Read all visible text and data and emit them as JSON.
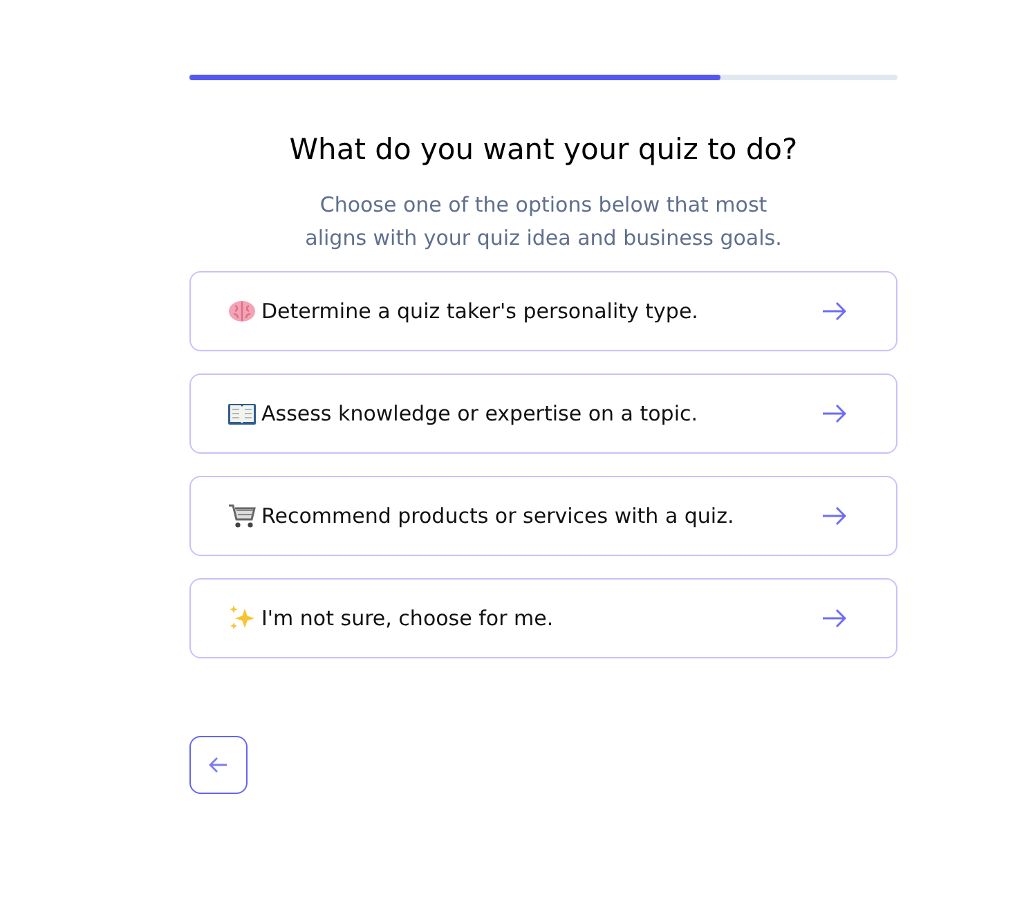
{
  "progress": {
    "level": 0.75
  },
  "title": "What do you want your quiz to do?",
  "subtitle": "Choose one of the options below that most aligns with your quiz idea and business goals.",
  "options": [
    {
      "kind": "brain",
      "label": "Determine a quiz taker's personality type."
    },
    {
      "kind": "book",
      "label": "Assess knowledge or expertise on a topic."
    },
    {
      "kind": "cart",
      "label": "Recommend products or services with a quiz."
    },
    {
      "kind": "sparkles",
      "label": "I'm not sure, choose for me."
    }
  ]
}
